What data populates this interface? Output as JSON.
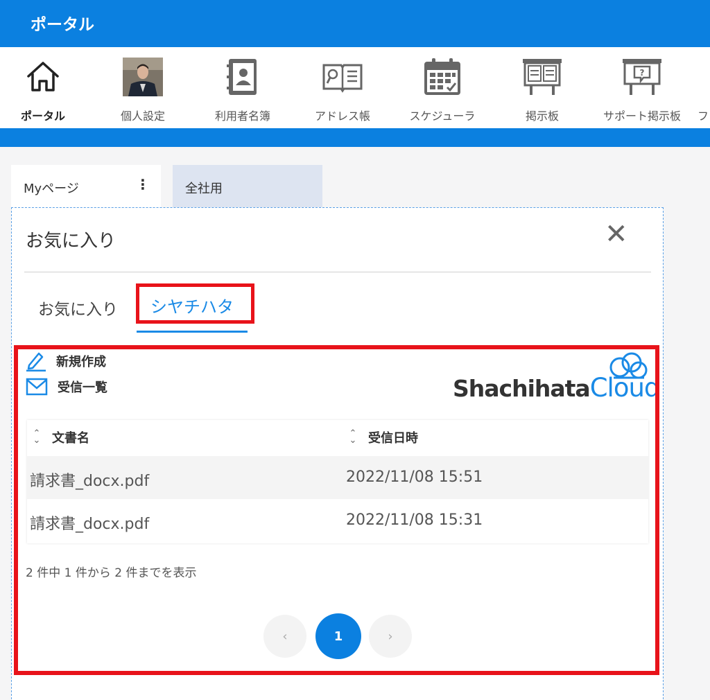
{
  "header": {
    "title": "ポータル"
  },
  "nav": {
    "items": [
      {
        "label": "ポータル",
        "icon": "home-icon"
      },
      {
        "label": "個人設定",
        "icon": "user-photo"
      },
      {
        "label": "利用者名簿",
        "icon": "contact-book-icon"
      },
      {
        "label": "アドレス帳",
        "icon": "address-book-icon"
      },
      {
        "label": "スケジューラ",
        "icon": "calendar-icon"
      },
      {
        "label": "掲示板",
        "icon": "bulletin-board-icon"
      },
      {
        "label": "サポート掲示板",
        "icon": "support-board-icon"
      },
      {
        "label": "フ",
        "icon": ""
      }
    ]
  },
  "page_tabs": {
    "my_page": "Myページ",
    "kebab": "⋮",
    "company": "全社用"
  },
  "widget": {
    "title": "お気に入り",
    "close": "✕",
    "tabs": {
      "favorites": "お気に入り",
      "shachihata": "シヤチハタ"
    },
    "actions": {
      "new": "新規作成",
      "inbox": "受信一覧"
    },
    "logo": {
      "part1": "Shachihata",
      "part2": "Cloud"
    },
    "table": {
      "headers": {
        "name": "文書名",
        "received": "受信日時"
      },
      "rows": [
        {
          "name": "請求書_docx.pdf",
          "received": "2022/11/08 15:51"
        },
        {
          "name": "請求書_docx.pdf",
          "received": "2022/11/08 15:31"
        }
      ]
    },
    "summary": "2 件中 1 件から 2 件までを表示",
    "pagination": {
      "prev": "‹",
      "current": "1",
      "next": "›"
    }
  },
  "colors": {
    "brand_blue": "#0b80e0",
    "highlight_red": "#e8131a",
    "tab_active": "#1a8ae6"
  }
}
